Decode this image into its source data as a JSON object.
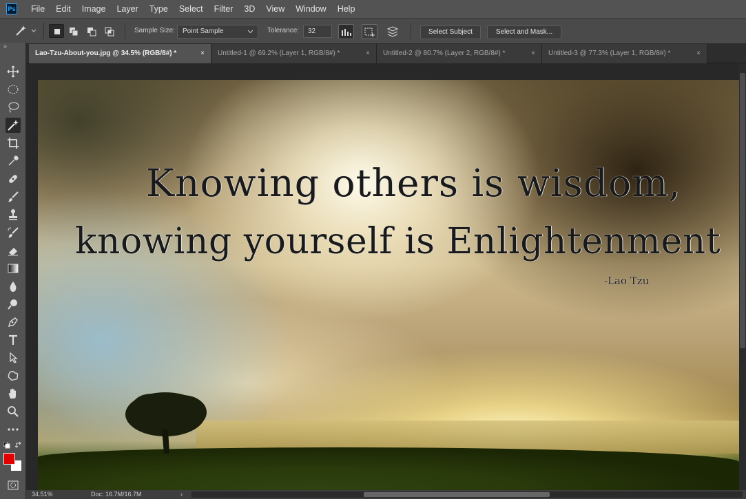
{
  "app": {
    "logo": "Ps"
  },
  "menu": [
    "File",
    "Edit",
    "Image",
    "Layer",
    "Type",
    "Select",
    "Filter",
    "3D",
    "View",
    "Window",
    "Help"
  ],
  "options": {
    "tool_icon": "magic-wand-icon",
    "sample_size_label": "Sample Size:",
    "sample_size_value": "Point Sample",
    "tolerance_label": "Tolerance:",
    "tolerance_value": "32",
    "select_subject": "Select Subject",
    "select_and_mask": "Select and Mask..."
  },
  "tabs": [
    {
      "label": "Lao-Tzu-About-you.jpg @ 34.5% (RGB/8#) *",
      "active": true
    },
    {
      "label": "Untitled-1 @ 69.2% (Layer 1, RGB/8#) *"
    },
    {
      "label": "Untitled-2 @ 80.7% (Layer 2, RGB/8#) *"
    },
    {
      "label": "Untitled-3 @ 77.3% (Layer 1, RGB/8#) *"
    }
  ],
  "tab_close": "×",
  "toolbar_collapse": "»",
  "tools": [
    "move-icon",
    "ellipse-marquee-icon",
    "lasso-icon",
    "magic-wand-icon",
    "crop-icon",
    "eyedropper-icon",
    "healing-brush-icon",
    "brush-icon",
    "clone-stamp-icon",
    "history-brush-icon",
    "eraser-icon",
    "gradient-icon",
    "blur-icon",
    "dodge-icon",
    "pen-icon",
    "type-icon",
    "path-selection-icon",
    "custom-shape-icon",
    "hand-icon",
    "zoom-icon",
    "more-tools-icon"
  ],
  "colors": {
    "foreground": "#e30000",
    "background": "#ffffff"
  },
  "canvas": {
    "line1": "Knowing others is wisdom,",
    "line2": "knowing yourself is Enlightenment",
    "author": "-Lao Tzu"
  },
  "status": {
    "zoom": "34.51%",
    "doc": "Doc: 16.7M/16.7M",
    "arrow": "›"
  }
}
